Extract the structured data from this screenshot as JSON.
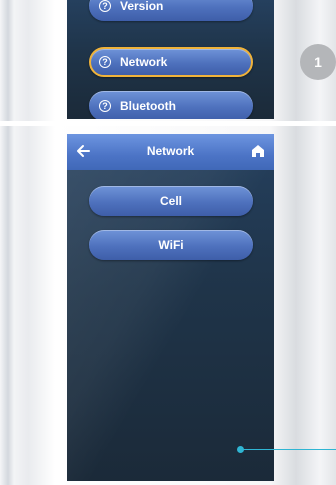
{
  "top_screen": {
    "menu_items": [
      {
        "label": "Version"
      },
      {
        "label": "Network",
        "selected": true
      },
      {
        "label": "Bluetooth"
      }
    ],
    "item_icon": "question-circle-icon",
    "selected_outline_color": "#f0b33a"
  },
  "step_badge": {
    "number": "1"
  },
  "bottom_screen": {
    "header": {
      "title": "Network",
      "back_icon": "arrow-left-icon",
      "home_icon": "home-icon"
    },
    "options": [
      {
        "label": "Cell"
      },
      {
        "label": "WiFi"
      }
    ]
  },
  "callout_color": "#2fb5d3"
}
